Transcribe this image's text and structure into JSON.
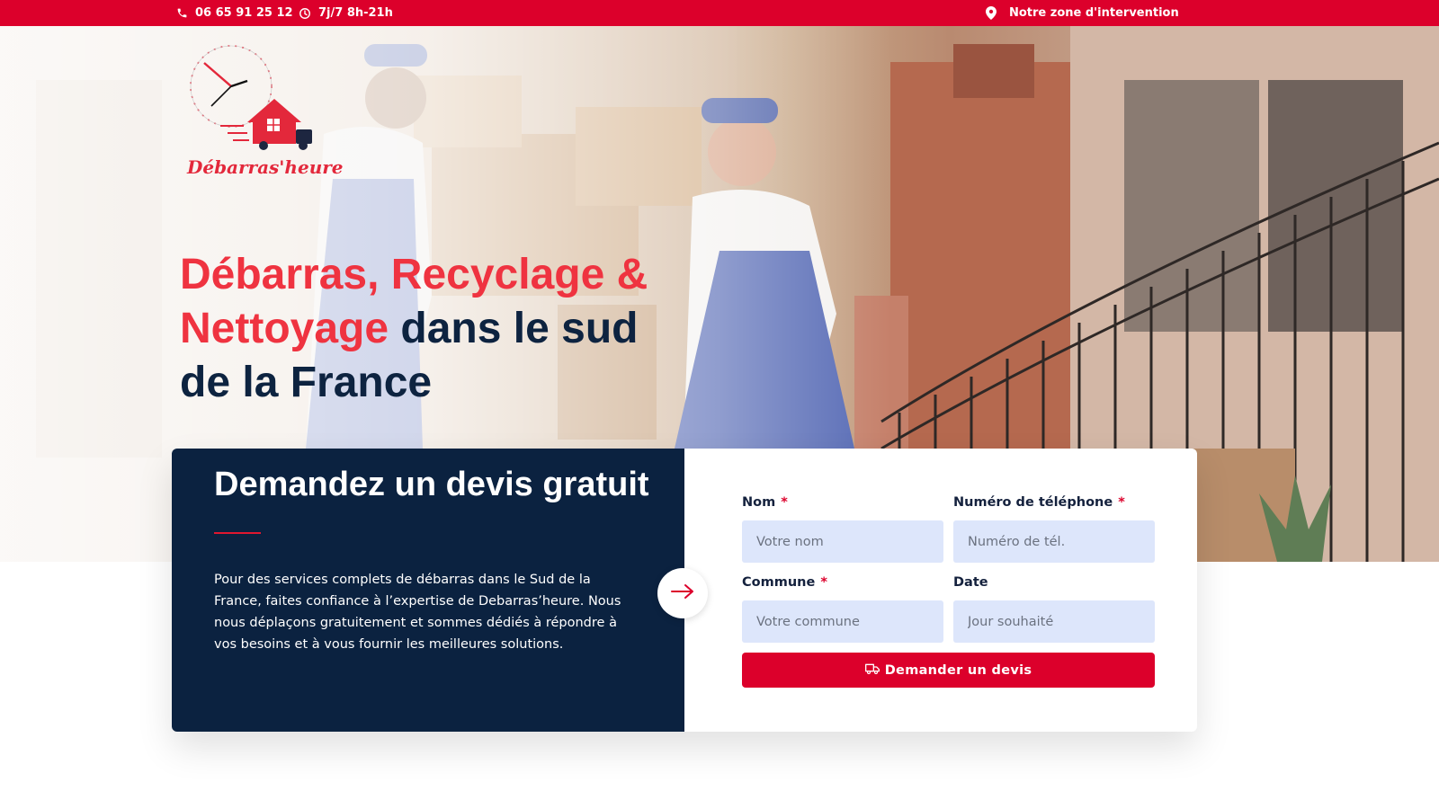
{
  "topbar": {
    "phone": "06 65 91 25 12",
    "hours": "7j/7 8h-21h",
    "zone_link": "Notre zone d'intervention"
  },
  "brand": {
    "name": "Débarras'heure"
  },
  "hero": {
    "headline_red_1": "Débarras, Recyclage &",
    "headline_red_2": "Nettoyage",
    "headline_dark_1": " dans le sud",
    "headline_dark_2": "de la France"
  },
  "quote_card": {
    "title": "Demandez un devis gratuit",
    "description": "Pour des services complets de débarras dans le Sud de la France, faites confiance à l’expertise de Debarras’heure. Nous nous déplaçons gratuitement et sommes dédiés à répondre à vos besoins et à vous fournir les meilleures solutions."
  },
  "form": {
    "nom": {
      "label": "Nom",
      "required": "*",
      "placeholder": "Votre nom"
    },
    "telephone": {
      "label": "Numéro de téléphone",
      "required": "*",
      "placeholder": "Numéro de tél."
    },
    "commune": {
      "label": "Commune",
      "required": "*",
      "placeholder": "Votre commune"
    },
    "date": {
      "label": "Date",
      "placeholder": "Jour souhaité"
    },
    "submit_label": "Demander un devis"
  },
  "colors": {
    "brand_red": "#dc002b",
    "navy": "#0b2240",
    "input_bg": "#dde6fb"
  },
  "icons": [
    "phone-icon",
    "clock-icon",
    "map-pin-icon",
    "arrow-right-icon",
    "truck-icon"
  ]
}
